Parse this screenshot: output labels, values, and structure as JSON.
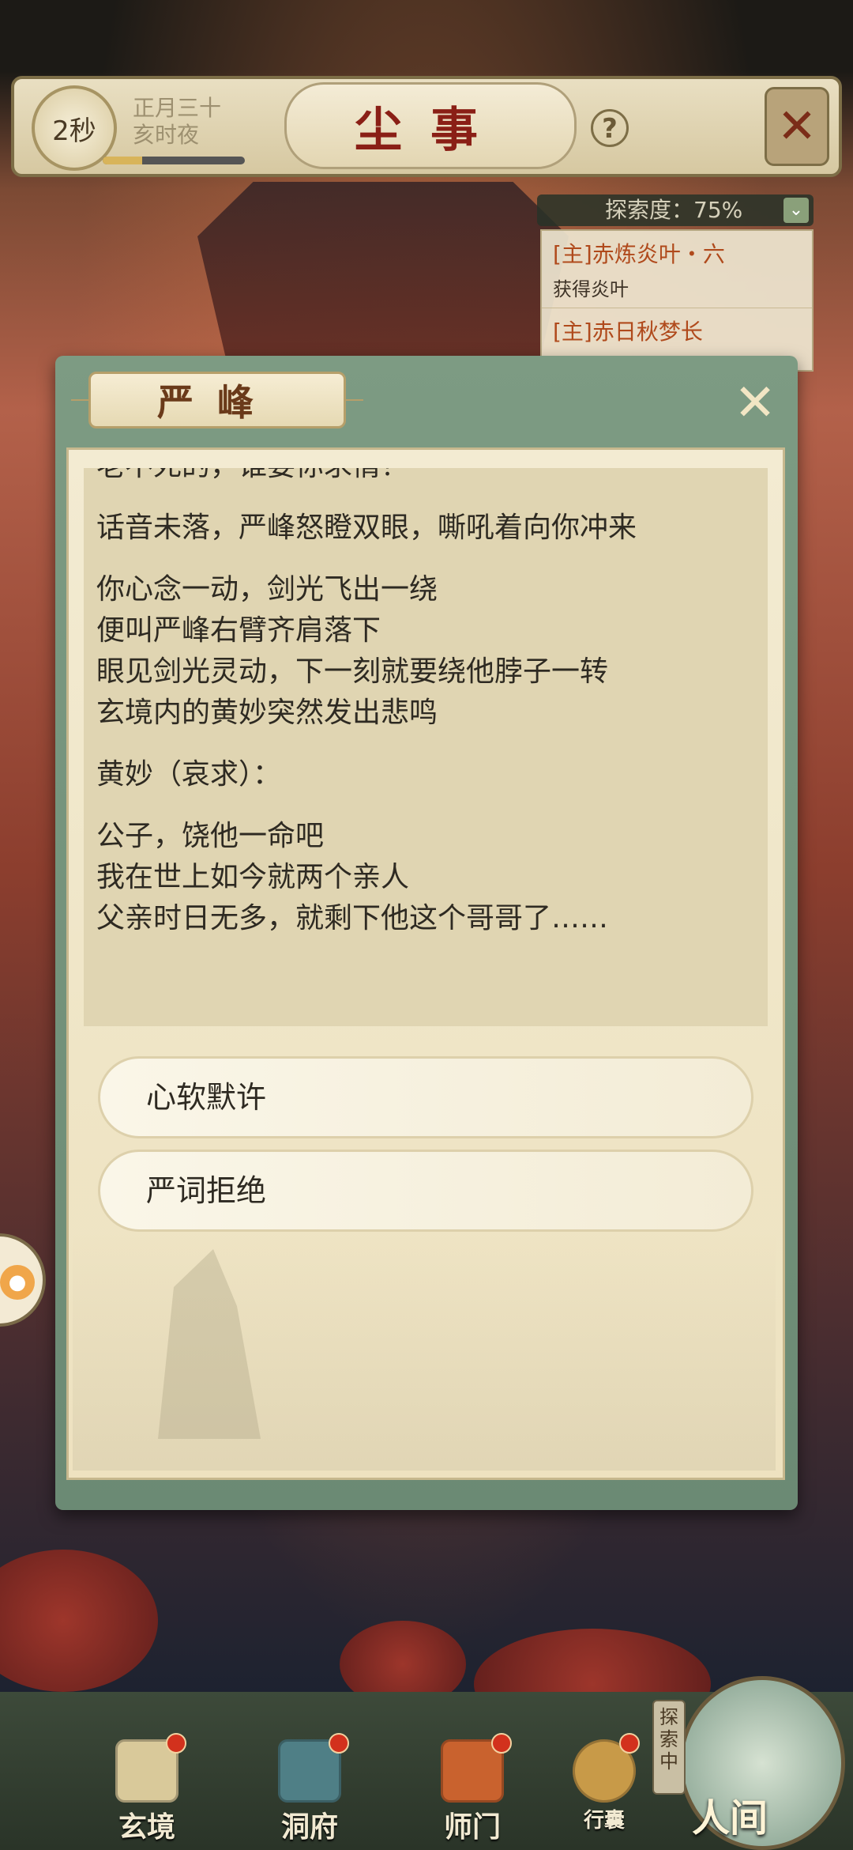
{
  "top_bar": {
    "timer": "2秒",
    "date_line1": "正月三十",
    "date_line2": "亥时夜",
    "title": "尘事",
    "help_icon": "?"
  },
  "explore_panel": {
    "header": "探索度：75%",
    "chevron": "⌄",
    "entries": [
      {
        "title": "[主]赤炼炎叶・六",
        "detail": "获得炎叶"
      },
      {
        "title": "[主]赤日秋梦长",
        "detail": ""
      }
    ]
  },
  "dialog": {
    "title": "严峰",
    "close_icon": "✕",
    "paragraphs": [
      "老不死的，谁要你求情？",
      "话音未落，严峰怒瞪双眼，嘶吼着向你冲来",
      "你心念一动，剑光飞出一绕\n便叫严峰右臂齐肩落下\n眼见剑光灵动，下一刻就要绕他脖子一转\n玄境内的黄妙突然发出悲鸣",
      "黄妙（哀求）：",
      "公子，饶他一命吧\n我在世上如今就两个亲人\n父亲时日无多，就剩下他这个哥哥了……"
    ],
    "choices": [
      "心软默许",
      "严词拒绝"
    ]
  },
  "bottom_nav": {
    "items": [
      "玄境",
      "洞府",
      "师门",
      "行囊"
    ],
    "explore_badge": "探索中",
    "world_label": "人间"
  },
  "colors": {
    "title_red": "#8a1f16",
    "dialog_green": "#7d9b83",
    "paper": "#f3ebd2",
    "badge_red": "#d2311d"
  },
  "progress": {
    "timer_fill": 0.28
  }
}
